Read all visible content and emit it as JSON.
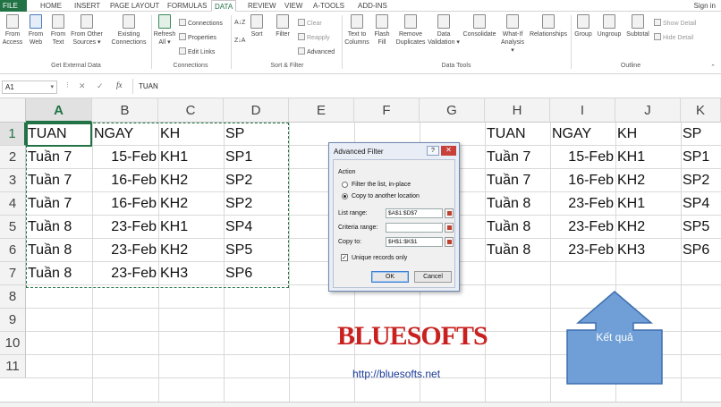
{
  "tabs": {
    "file": "FILE",
    "home": "HOME",
    "insert": "INSERT",
    "page_layout": "PAGE LAYOUT",
    "formulas": "FORMULAS",
    "data": "DATA",
    "review": "REVIEW",
    "view": "VIEW",
    "a_tools": "A-TOOLS",
    "add_ins": "ADD-INS",
    "sign_in": "Sign in"
  },
  "ribbon": {
    "from_access": "From\nAccess",
    "from_web": "From\nWeb",
    "from_text": "From\nText",
    "from_other": "From Other\nSources ▾",
    "existing": "Existing\nConnections",
    "refresh": "Refresh\nAll ▾",
    "connections": "Connections",
    "properties": "Properties",
    "edit_links": "Edit Links",
    "sort_az": "A↓Z",
    "sort_za": "Z↓A",
    "sort": "Sort",
    "filter": "Filter",
    "clear": "Clear",
    "reapply": "Reapply",
    "advanced": "Advanced",
    "text_to_columns": "Text to\nColumns",
    "flash_fill": "Flash\nFill",
    "remove_dup": "Remove\nDuplicates",
    "data_validation": "Data\nValidation ▾",
    "consolidate": "Consolidate",
    "what_if": "What-If\nAnalysis ▾",
    "relationships": "Relationships",
    "group": "Group",
    "ungroup": "Ungroup",
    "subtotal": "Subtotal",
    "show_detail": "Show Detail",
    "hide_detail": "Hide Detail",
    "groups": {
      "get_external": "Get External Data",
      "connections": "Connections",
      "sort_filter": "Sort & Filter",
      "data_tools": "Data Tools",
      "outline": "Outline"
    }
  },
  "formula_bar": {
    "name_box": "A1",
    "content": "TUAN",
    "fx": "fx",
    "cancel": "✕",
    "enter": "✓"
  },
  "sheet": {
    "columns": [
      "A",
      "B",
      "C",
      "D",
      "E",
      "F",
      "G",
      "H",
      "I",
      "J",
      "K"
    ],
    "rows": [
      "1",
      "2",
      "3",
      "4",
      "5",
      "6",
      "7",
      "8",
      "9",
      "10",
      "11"
    ],
    "source": [
      [
        "TUAN",
        "NGAY",
        "KH",
        "SP"
      ],
      [
        "Tuần 7",
        "15-Feb",
        "KH1",
        "SP1"
      ],
      [
        "Tuần 7",
        "16-Feb",
        "KH2",
        "SP2"
      ],
      [
        "Tuần 7",
        "16-Feb",
        "KH2",
        "SP2"
      ],
      [
        "Tuần 8",
        "23-Feb",
        "KH1",
        "SP4"
      ],
      [
        "Tuần 8",
        "23-Feb",
        "KH2",
        "SP5"
      ],
      [
        "Tuần 8",
        "23-Feb",
        "KH3",
        "SP6"
      ]
    ],
    "result": [
      [
        "TUAN",
        "NGAY",
        "KH",
        "SP"
      ],
      [
        "Tuần 7",
        "15-Feb",
        "KH1",
        "SP1"
      ],
      [
        "Tuần 7",
        "16-Feb",
        "KH2",
        "SP2"
      ],
      [
        "Tuần 8",
        "23-Feb",
        "KH1",
        "SP4"
      ],
      [
        "Tuần 8",
        "23-Feb",
        "KH2",
        "SP5"
      ],
      [
        "Tuần 8",
        "23-Feb",
        "KH3",
        "SP6"
      ]
    ]
  },
  "dialog": {
    "title": "Advanced Filter",
    "help": "?",
    "close": "✕",
    "action_label": "Action",
    "opt_in_place": "Filter the list, in-place",
    "opt_copy": "Copy to another location",
    "list_range_label": "List range:",
    "list_range_value": "$A$1:$D$7",
    "criteria_label": "Criteria range:",
    "criteria_value": "",
    "copy_to_label": "Copy to:",
    "copy_to_value": "$H$1:$K$1",
    "unique_label": "Unique records only",
    "unique_checked": "✓",
    "ok": "OK",
    "cancel": "Cancel"
  },
  "watermark": {
    "logo": "BLUESOFTS",
    "url": "http://bluesofts.net"
  },
  "callout": {
    "text": "Kết quả",
    "fill": "#6f9fd6",
    "stroke": "#3f6fb0"
  },
  "colors": {
    "excel_green": "#217346"
  }
}
